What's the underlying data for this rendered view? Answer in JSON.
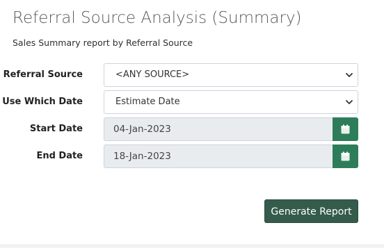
{
  "page": {
    "title": "Referral Source Analysis (Summary)",
    "subtitle": "Sales Summary report by Referral Source"
  },
  "form": {
    "referral_source": {
      "label": "Referral Source",
      "value": "<ANY SOURCE>"
    },
    "use_which_date": {
      "label": "Use Which Date",
      "value": "Estimate Date"
    },
    "start_date": {
      "label": "Start Date",
      "value": "04-Jan-2023"
    },
    "end_date": {
      "label": "End Date",
      "value": "18-Jan-2023"
    }
  },
  "actions": {
    "generate_label": "Generate Report"
  },
  "colors": {
    "accent": "#2e7d5a",
    "button": "#345b4b",
    "readonly_bg": "#e9ecef"
  },
  "icons": {
    "dropdown": "chevron-down-icon",
    "calendar": "calendar-icon"
  }
}
